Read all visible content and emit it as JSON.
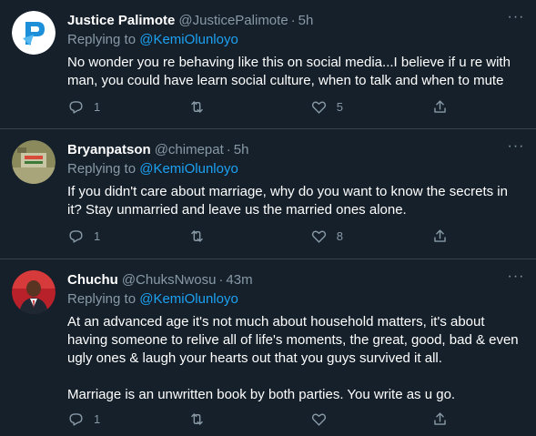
{
  "tweets": [
    {
      "name": "Justice Palimote",
      "handle": "@JusticePalimote",
      "time": "5h",
      "replying_prefix": "Replying to ",
      "replying_to": "@KemiOlunloyo",
      "text": "No wonder you re behaving like this on social media...I believe if u re with man, you could have learn social culture, when to talk and when to mute",
      "replies": "1",
      "retweets": "",
      "likes": "5",
      "avatar": "logo-avatar"
    },
    {
      "name": "Bryanpatson",
      "handle": "@chimepat",
      "time": "5h",
      "replying_prefix": "Replying to ",
      "replying_to": "@KemiOlunloyo",
      "text": "If you didn't care about marriage, why do you want to know the secrets in it? Stay unmarried and leave us the married ones alone.",
      "replies": "1",
      "retweets": "",
      "likes": "8",
      "avatar": "photo-avatar"
    },
    {
      "name": "Chuchu",
      "handle": "@ChuksNwosu",
      "time": "43m",
      "replying_prefix": "Replying to ",
      "replying_to": "@KemiOlunloyo",
      "text": "At an advanced age it's not much about household matters, it's about having someone to relive all of life's moments, the great, good, bad & even ugly ones & laugh your hearts out that you guys survived it all.\n\nMarriage is an unwritten book by both parties. You write as u go.",
      "replies": "1",
      "retweets": "",
      "likes": "",
      "avatar": "photo-avatar"
    }
  ],
  "separator": "·",
  "more_label": "···",
  "colors": {
    "background": "#15202b",
    "secondary_text": "#8899a6",
    "link": "#1da1f2",
    "border": "#38444d"
  },
  "icons": [
    "reply-icon",
    "retweet-icon",
    "like-icon",
    "share-icon",
    "more-icon"
  ]
}
